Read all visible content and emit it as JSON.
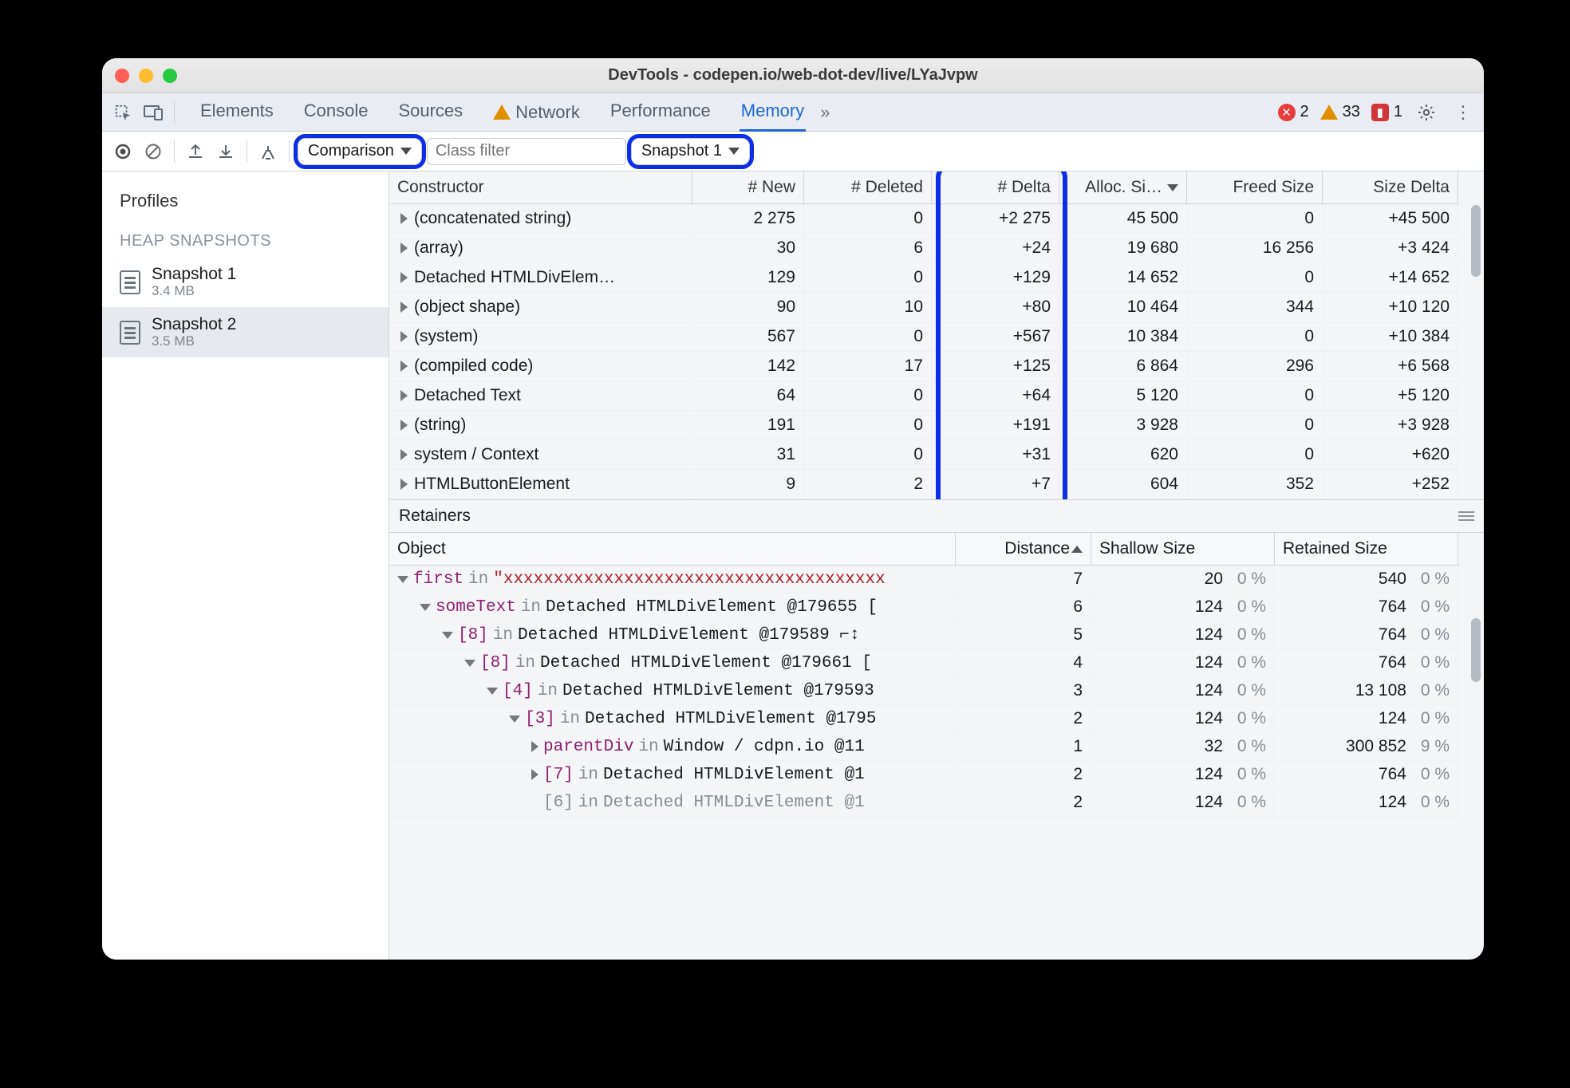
{
  "window": {
    "title": "DevTools - codepen.io/web-dot-dev/live/LYaJvpw"
  },
  "tabs": {
    "items": [
      "Elements",
      "Console",
      "Sources",
      "Network",
      "Performance",
      "Memory"
    ],
    "active_index": 5,
    "network_has_warning": true
  },
  "status": {
    "errors": 2,
    "warnings": 33,
    "issues": 1
  },
  "mem_toolbar": {
    "view_mode": "Comparison",
    "class_filter_placeholder": "Class filter",
    "baseline_snapshot": "Snapshot 1"
  },
  "sidebar": {
    "profiles_label": "Profiles",
    "heap_section_label": "HEAP SNAPSHOTS",
    "snapshots": [
      {
        "name": "Snapshot 1",
        "size": "3.4 MB"
      },
      {
        "name": "Snapshot 2",
        "size": "3.5 MB"
      }
    ],
    "selected_index": 1
  },
  "columns": {
    "constructor": "Constructor",
    "new": "# New",
    "deleted": "# Deleted",
    "delta": "# Delta",
    "alloc": "Alloc. Si…",
    "freed": "Freed Size",
    "sizedelta": "Size Delta"
  },
  "rows": [
    {
      "ctor": "(concatenated string)",
      "new": "2 275",
      "deleted": "0",
      "delta": "+2 275",
      "alloc": "45 500",
      "freed": "0",
      "sizedelta": "+45 500"
    },
    {
      "ctor": "(array)",
      "new": "30",
      "deleted": "6",
      "delta": "+24",
      "alloc": "19 680",
      "freed": "16 256",
      "sizedelta": "+3 424"
    },
    {
      "ctor": "Detached HTMLDivElem…",
      "new": "129",
      "deleted": "0",
      "delta": "+129",
      "alloc": "14 652",
      "freed": "0",
      "sizedelta": "+14 652"
    },
    {
      "ctor": "(object shape)",
      "new": "90",
      "deleted": "10",
      "delta": "+80",
      "alloc": "10 464",
      "freed": "344",
      "sizedelta": "+10 120"
    },
    {
      "ctor": "(system)",
      "new": "567",
      "deleted": "0",
      "delta": "+567",
      "alloc": "10 384",
      "freed": "0",
      "sizedelta": "+10 384"
    },
    {
      "ctor": "(compiled code)",
      "new": "142",
      "deleted": "17",
      "delta": "+125",
      "alloc": "6 864",
      "freed": "296",
      "sizedelta": "+6 568"
    },
    {
      "ctor": "Detached Text",
      "new": "64",
      "deleted": "0",
      "delta": "+64",
      "alloc": "5 120",
      "freed": "0",
      "sizedelta": "+5 120"
    },
    {
      "ctor": "(string)",
      "new": "191",
      "deleted": "0",
      "delta": "+191",
      "alloc": "3 928",
      "freed": "0",
      "sizedelta": "+3 928"
    },
    {
      "ctor": "system / Context",
      "new": "31",
      "deleted": "0",
      "delta": "+31",
      "alloc": "620",
      "freed": "0",
      "sizedelta": "+620"
    },
    {
      "ctor": "HTMLButtonElement",
      "new": "9",
      "deleted": "2",
      "delta": "+7",
      "alloc": "604",
      "freed": "352",
      "sizedelta": "+252"
    }
  ],
  "retainers": {
    "title": "Retainers",
    "columns": {
      "object": "Object",
      "distance": "Distance",
      "shallow": "Shallow Size",
      "retained": "Retained Size"
    },
    "rows": [
      {
        "indent": 0,
        "arrow": "down",
        "prop": "first",
        "sep": "in",
        "rest": "\"xxxxxxxxxxxxxxxxxxxxxxxxxxxxxxxxxxxxxx",
        "rest_class": "redtxt",
        "dist": "7",
        "shallow": "20",
        "shallow_pct": "0 %",
        "retained": "540",
        "retained_pct": "0 %"
      },
      {
        "indent": 1,
        "arrow": "down",
        "prop": "someText",
        "sep": "in",
        "rest": "Detached HTMLDivElement @179655 [",
        "dist": "6",
        "shallow": "124",
        "shallow_pct": "0 %",
        "retained": "764",
        "retained_pct": "0 %"
      },
      {
        "indent": 2,
        "arrow": "down",
        "prop": "[8]",
        "sep": "in",
        "rest": "Detached HTMLDivElement @179589 ⌐↕",
        "dist": "5",
        "shallow": "124",
        "shallow_pct": "0 %",
        "retained": "764",
        "retained_pct": "0 %"
      },
      {
        "indent": 3,
        "arrow": "down",
        "prop": "[8]",
        "sep": "in",
        "rest": "Detached HTMLDivElement @179661 [",
        "dist": "4",
        "shallow": "124",
        "shallow_pct": "0 %",
        "retained": "764",
        "retained_pct": "0 %"
      },
      {
        "indent": 4,
        "arrow": "down",
        "prop": "[4]",
        "sep": "in",
        "rest": "Detached HTMLDivElement @179593",
        "dist": "3",
        "shallow": "124",
        "shallow_pct": "0 %",
        "retained": "13 108",
        "retained_pct": "0 %"
      },
      {
        "indent": 5,
        "arrow": "down",
        "prop": "[3]",
        "sep": "in",
        "rest": "Detached HTMLDivElement @1795",
        "dist": "2",
        "shallow": "124",
        "shallow_pct": "0 %",
        "retained": "124",
        "retained_pct": "0 %"
      },
      {
        "indent": 6,
        "arrow": "right",
        "prop": "parentDiv",
        "sep": "in",
        "rest": "Window / cdpn.io @11",
        "dist": "1",
        "shallow": "32",
        "shallow_pct": "0 %",
        "retained": "300 852",
        "retained_pct": "9 %"
      },
      {
        "indent": 6,
        "arrow": "right",
        "prop": "[7]",
        "sep": "in",
        "rest": "Detached HTMLDivElement @1",
        "dist": "2",
        "shallow": "124",
        "shallow_pct": "0 %",
        "retained": "764",
        "retained_pct": "0 %"
      },
      {
        "indent": 6,
        "arrow": "none",
        "prop": "[6]",
        "sep": "in",
        "rest": "Detached HTMLDivElement @1",
        "rest_class": "gray",
        "prop_class": "gray",
        "sep_class": "gray",
        "dist": "2",
        "shallow": "124",
        "shallow_pct": "0 %",
        "retained": "124",
        "retained_pct": "0 %"
      }
    ]
  }
}
